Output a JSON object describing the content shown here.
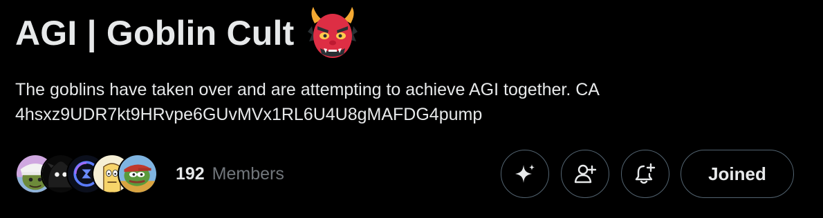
{
  "community": {
    "name": "AGI | Goblin Cult",
    "title_emoji": "japanese-goblin-emoji",
    "description_line1": "The goblins have taken over and are attempting to achieve AGI together. CA",
    "description_line2": "4hsxz9UDR7kt9HRvpe6GUvMVx1RL6U4U8gMAFDG4pump"
  },
  "members": {
    "count": "192",
    "label": "Members",
    "avatars": [
      "avatar-goblin-hat",
      "avatar-dark-glowing-eyes",
      "avatar-blue-logo",
      "avatar-cartoon-face",
      "avatar-pepe"
    ]
  },
  "actions": {
    "grok_icon": "sparkle-icon",
    "invite_icon": "add-person-icon",
    "notify_icon": "bell-plus-icon",
    "joined_label": "Joined"
  },
  "colors": {
    "background": "#000000",
    "text_primary": "#e7e9ea",
    "text_secondary": "#71767b",
    "button_border": "#536471"
  }
}
